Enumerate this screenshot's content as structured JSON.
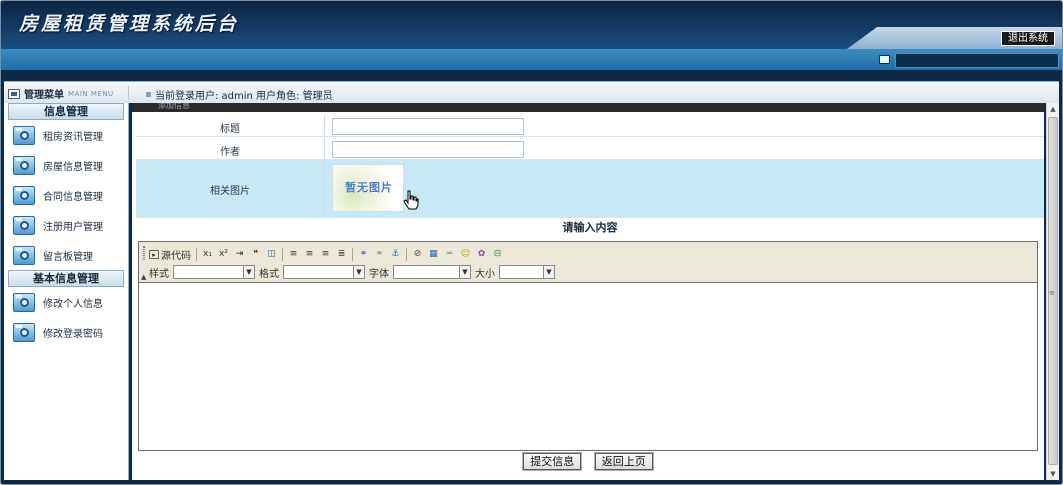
{
  "header": {
    "title": "房屋租赁管理系统后台",
    "logout_label": "退出系统"
  },
  "menubar": {
    "title": "管理菜单",
    "subtitle": "MAIN MENU",
    "user_info": "当前登录用户: admin 用户角色: 管理员"
  },
  "sidebar": {
    "sections": [
      {
        "title": "信息管理",
        "items": [
          {
            "label": "租房资讯管理",
            "icon": "gear-icon"
          },
          {
            "label": "房屋信息管理",
            "icon": "gear-icon"
          },
          {
            "label": "合同信息管理",
            "icon": "gear-icon"
          },
          {
            "label": "注册用户管理",
            "icon": "gear-icon"
          },
          {
            "label": "留言板管理",
            "icon": "gear-icon"
          }
        ]
      },
      {
        "title": "基本信息管理",
        "items": [
          {
            "label": "修改个人信息",
            "icon": "gear-icon"
          },
          {
            "label": "修改登录密码",
            "icon": "gear-icon"
          }
        ]
      }
    ]
  },
  "form": {
    "panel_title": "添加信息",
    "fields": {
      "title_label": "标题",
      "title_value": "",
      "author_label": "作者",
      "author_value": "",
      "image_label": "相关图片",
      "image_placeholder": "暂无图片"
    },
    "content_title": "请输入内容"
  },
  "editor": {
    "source_label": "源代码",
    "style_label": "样式",
    "format_label": "格式",
    "font_label": "字体",
    "size_label": "大小",
    "style_value": "",
    "format_value": "",
    "font_value": "",
    "size_value": ""
  },
  "buttons": {
    "submit_label": "提交信息",
    "back_label": "返回上页"
  }
}
